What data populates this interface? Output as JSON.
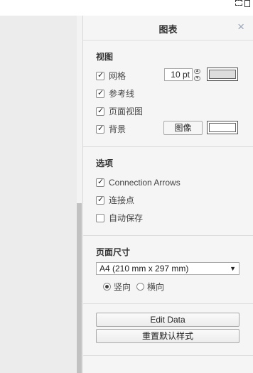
{
  "panel": {
    "title": "图表",
    "close_glyph": "×"
  },
  "view": {
    "title": "视图",
    "grid": {
      "label": "网格",
      "checked": true,
      "size_value": "10 pt",
      "color": "#dddddd"
    },
    "guides": {
      "label": "参考线",
      "checked": true
    },
    "page_view": {
      "label": "页面视图",
      "checked": true
    },
    "background": {
      "label": "背景",
      "checked": true,
      "image_button": "图像",
      "color": "#ffffff"
    }
  },
  "options": {
    "title": "选项",
    "connection_arrows": {
      "label": "Connection Arrows",
      "checked": true
    },
    "connection_points": {
      "label": "连接点",
      "checked": true
    },
    "autosave": {
      "label": "自动保存",
      "checked": false
    }
  },
  "page_size": {
    "title": "页面尺寸",
    "selected": "A4 (210 mm x 297 mm)",
    "orientation": {
      "portrait_label": "竖向",
      "landscape_label": "横向",
      "selected": "portrait"
    }
  },
  "actions": {
    "edit_data": "Edit Data",
    "reset_style": "重置默认样式"
  },
  "icons": {
    "close": "close-icon",
    "dropdown": "chevron-down-icon",
    "spinner_up": "spinner-up-icon",
    "spinner_down": "spinner-down-icon"
  }
}
